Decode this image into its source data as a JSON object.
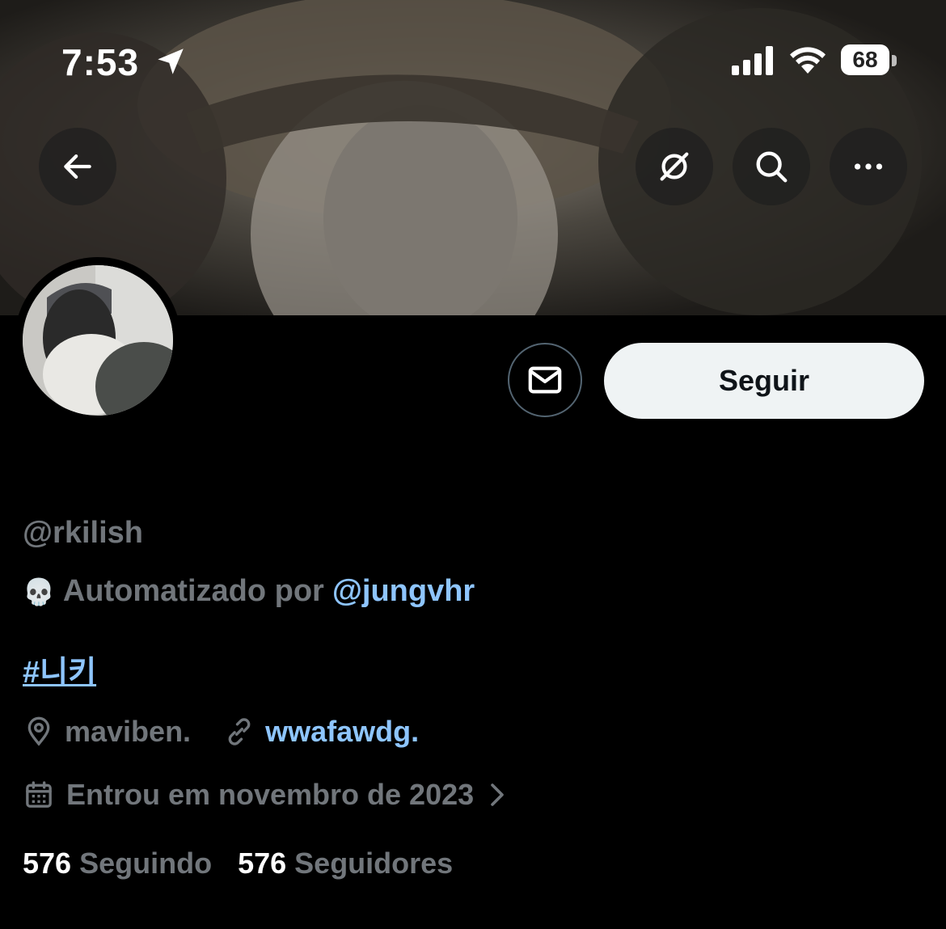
{
  "status_bar": {
    "time": "7:53",
    "battery": "68",
    "icons": [
      "location-arrow-icon",
      "cellular-signal-icon",
      "wifi-icon",
      "battery-icon"
    ]
  },
  "header": {
    "buttons": [
      "back-arrow-icon",
      "translate-icon",
      "search-icon",
      "more-icon"
    ]
  },
  "actions": {
    "dm_icon": "envelope-icon",
    "follow_label": "Seguir"
  },
  "profile": {
    "handle": "@rkilish",
    "automated_emoji": "💀",
    "automated_prefix": "Automatizado por",
    "automated_by": "@jungvhr",
    "bio_hashtag": "#니키",
    "location": "maviben.",
    "website": "wwafawdg.",
    "joined": "Entrou em novembro de 2023",
    "following_count": "576",
    "following_label": "Seguindo",
    "followers_count": "576",
    "followers_label": "Seguidores"
  },
  "colors": {
    "background": "#000000",
    "muted_text": "#71767b",
    "link": "#8ec5ff",
    "follow_button_bg": "#eff3f4"
  }
}
